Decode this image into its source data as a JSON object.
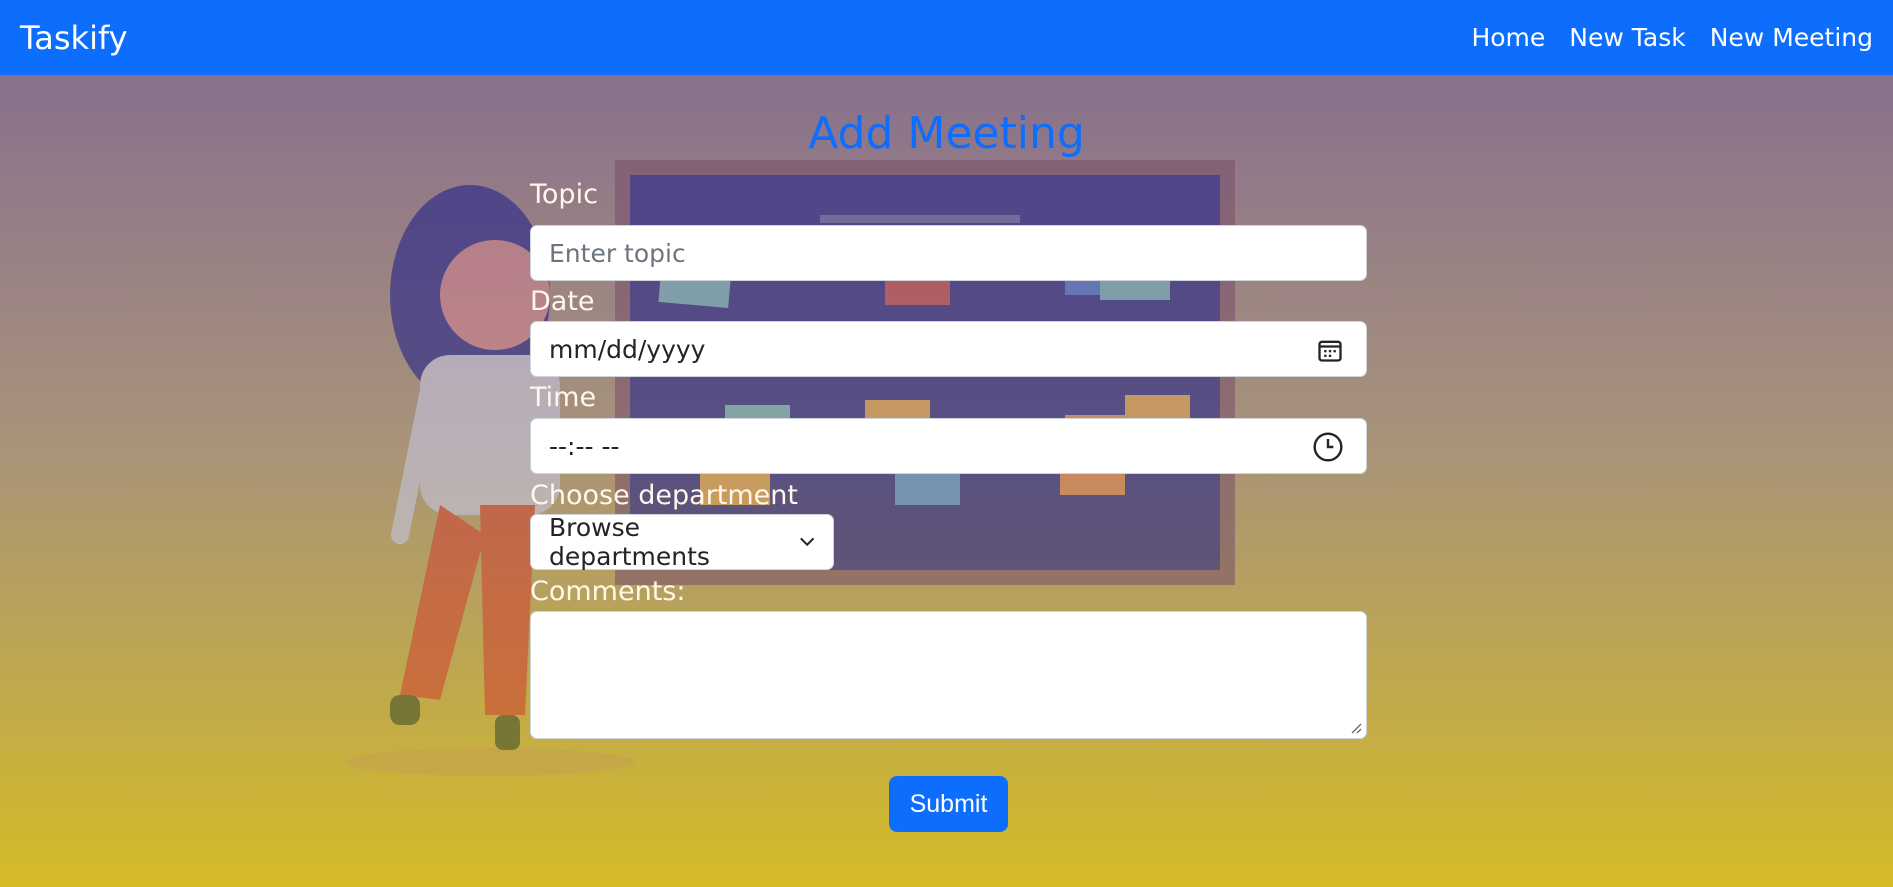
{
  "navbar": {
    "brand": "Taskify",
    "links": [
      "Home",
      "New Task",
      "New Meeting"
    ]
  },
  "page": {
    "title": "Add Meeting"
  },
  "form": {
    "topic": {
      "label": "Topic",
      "placeholder": "Enter topic"
    },
    "date": {
      "label": "Date",
      "value": "mm/dd/yyyy"
    },
    "time": {
      "label": "Time",
      "value": "--:-- --"
    },
    "department": {
      "label": "Choose department",
      "selected": "Browse departments"
    },
    "comments": {
      "label": "Comments:"
    },
    "submit_label": "Submit"
  },
  "colors": {
    "primary": "#0d6efd"
  },
  "icons": {
    "date": "calendar-icon",
    "time": "clock-icon",
    "select": "chevron-down-icon"
  }
}
